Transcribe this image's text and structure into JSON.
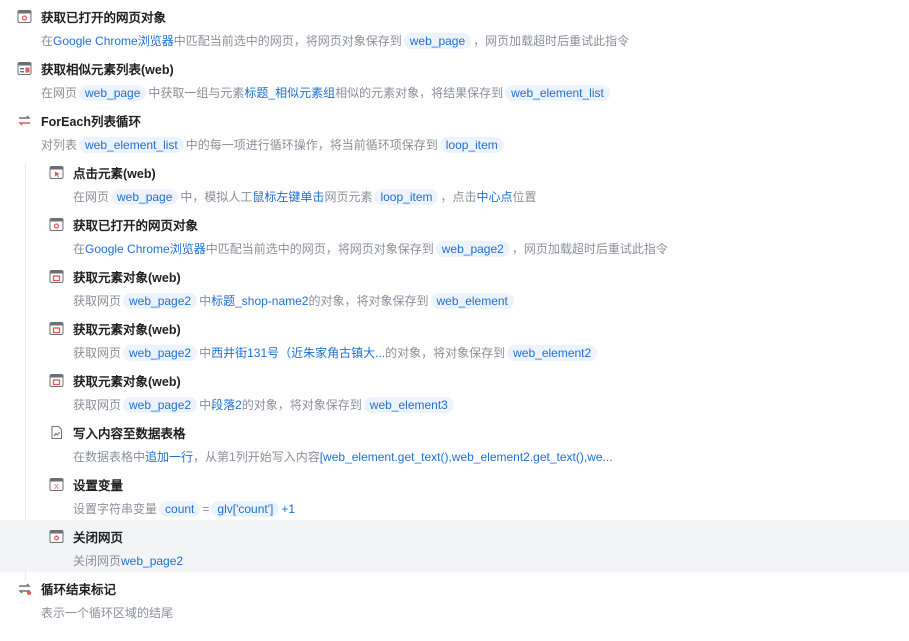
{
  "colors": {
    "highlight": "#1d6fd6",
    "chip_bg": "#edf3fd",
    "muted": "#8a8f99",
    "selected_bg": "#f3f4f6"
  },
  "steps": [
    {
      "icon": "browser-window-icon",
      "depth": 0,
      "title": "获取已打开的网页对象",
      "desc": [
        {
          "t": "t",
          "v": "在"
        },
        {
          "t": "h",
          "v": "Google Chrome浏览器"
        },
        {
          "t": "t",
          "v": "中匹配当前选中的网页，将网页对象保存到"
        },
        {
          "t": "c",
          "v": "web_page"
        },
        {
          "t": "t",
          "v": "，网页加载超时后重试此指令"
        }
      ]
    },
    {
      "icon": "element-list-icon",
      "depth": 0,
      "title": "获取相似元素列表(web)",
      "desc": [
        {
          "t": "t",
          "v": "在网页"
        },
        {
          "t": "c",
          "v": "web_page"
        },
        {
          "t": "t",
          "v": "中获取一组与元素"
        },
        {
          "t": "h",
          "v": "标题_相似元素组"
        },
        {
          "t": "t",
          "v": "相似的元素对象，将结果保存到"
        },
        {
          "t": "c",
          "v": "web_element_list"
        }
      ]
    },
    {
      "icon": "loop-icon",
      "depth": 0,
      "title": "ForEach列表循环",
      "desc": [
        {
          "t": "t",
          "v": "对列表"
        },
        {
          "t": "c",
          "v": "web_element_list"
        },
        {
          "t": "t",
          "v": "中的每一项进行循环操作，将当前循环项保存到"
        },
        {
          "t": "c",
          "v": "loop_item"
        }
      ]
    },
    {
      "icon": "click-element-icon",
      "depth": 1,
      "title": "点击元素(web)",
      "desc": [
        {
          "t": "t",
          "v": "在网页"
        },
        {
          "t": "c",
          "v": "web_page"
        },
        {
          "t": "t",
          "v": "中，模拟人工"
        },
        {
          "t": "h",
          "v": "鼠标左键单击"
        },
        {
          "t": "t",
          "v": "网页元素"
        },
        {
          "t": "c",
          "v": "loop_item"
        },
        {
          "t": "t",
          "v": "，点击"
        },
        {
          "t": "h",
          "v": "中心点"
        },
        {
          "t": "t",
          "v": "位置"
        }
      ]
    },
    {
      "icon": "browser-window-icon",
      "depth": 1,
      "title": "获取已打开的网页对象",
      "desc": [
        {
          "t": "t",
          "v": "在"
        },
        {
          "t": "h",
          "v": "Google Chrome浏览器"
        },
        {
          "t": "t",
          "v": "中匹配当前选中的网页，将网页对象保存到"
        },
        {
          "t": "c",
          "v": "web_page2"
        },
        {
          "t": "t",
          "v": "，网页加载超时后重试此指令"
        }
      ]
    },
    {
      "icon": "web-element-icon",
      "depth": 1,
      "title": "获取元素对象(web)",
      "desc": [
        {
          "t": "t",
          "v": "获取网页"
        },
        {
          "t": "c",
          "v": "web_page2"
        },
        {
          "t": "t",
          "v": "中"
        },
        {
          "t": "h",
          "v": "标题_shop-name2"
        },
        {
          "t": "t",
          "v": "的对象，将对象保存到"
        },
        {
          "t": "c",
          "v": "web_element"
        }
      ]
    },
    {
      "icon": "web-element-icon",
      "depth": 1,
      "title": "获取元素对象(web)",
      "desc": [
        {
          "t": "t",
          "v": "获取网页"
        },
        {
          "t": "c",
          "v": "web_page2"
        },
        {
          "t": "t",
          "v": "中"
        },
        {
          "t": "h",
          "v": "西井街131号（近朱家角古镇大..."
        },
        {
          "t": "t",
          "v": "的对象，将对象保存到"
        },
        {
          "t": "c",
          "v": "web_element2"
        }
      ]
    },
    {
      "icon": "web-element-icon",
      "depth": 1,
      "title": "获取元素对象(web)",
      "desc": [
        {
          "t": "t",
          "v": "获取网页"
        },
        {
          "t": "c",
          "v": "web_page2"
        },
        {
          "t": "t",
          "v": "中"
        },
        {
          "t": "h",
          "v": "段落2"
        },
        {
          "t": "t",
          "v": "的对象，将对象保存到"
        },
        {
          "t": "c",
          "v": "web_element3"
        }
      ]
    },
    {
      "icon": "spreadsheet-file-icon",
      "depth": 1,
      "title": "写入内容至数据表格",
      "desc": [
        {
          "t": "t",
          "v": "在数据表格中"
        },
        {
          "t": "h",
          "v": "追加一行"
        },
        {
          "t": "t",
          "v": "，从第1列开始写入内容"
        },
        {
          "t": "h",
          "v": "[web_element.get_text(),web_element2.get_text(),we..."
        }
      ]
    },
    {
      "icon": "set-variable-icon",
      "depth": 1,
      "title": "设置变量",
      "desc": [
        {
          "t": "t",
          "v": "设置字符串变量"
        },
        {
          "t": "c",
          "v": "count"
        },
        {
          "t": "t",
          "v": "="
        },
        {
          "t": "c",
          "v": "glv['count']"
        },
        {
          "t": "h",
          "v": "+1"
        }
      ]
    },
    {
      "icon": "close-page-icon",
      "depth": 1,
      "title": "关闭网页",
      "selected": true,
      "desc": [
        {
          "t": "t",
          "v": "关闭网页"
        },
        {
          "t": "h",
          "v": "web_page2"
        }
      ]
    },
    {
      "icon": "loop-end-icon",
      "depth": 0,
      "title": "循环结束标记",
      "desc": [
        {
          "t": "t",
          "v": "表示一个循环区域的结尾"
        }
      ]
    }
  ]
}
